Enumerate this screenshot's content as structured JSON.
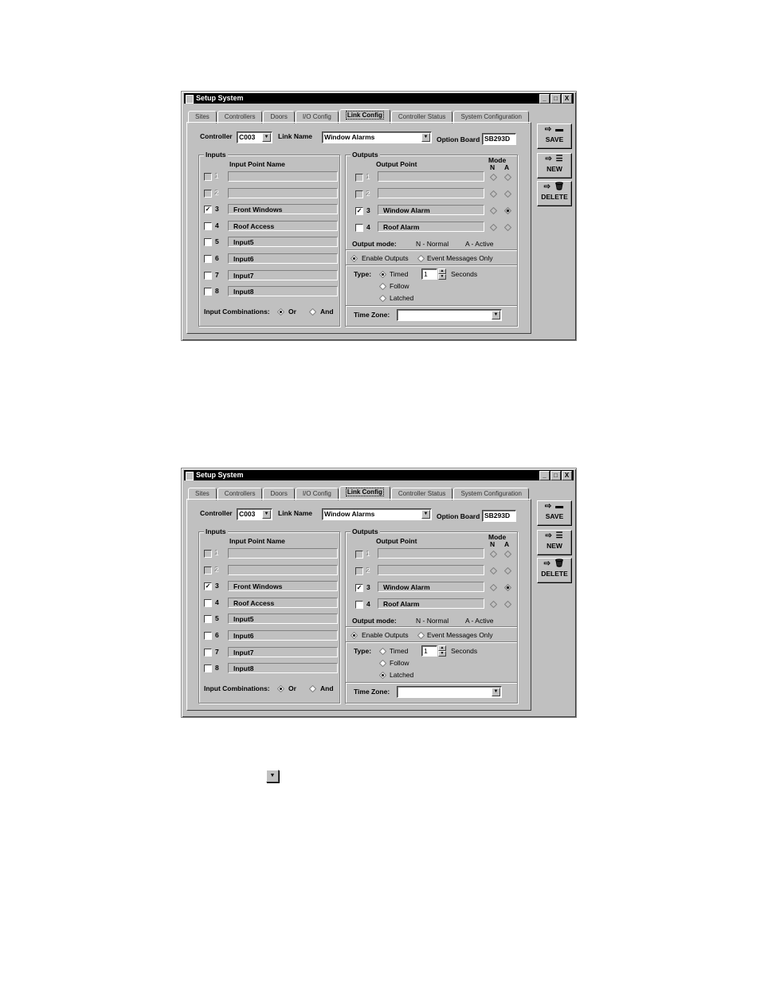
{
  "windows": [
    {
      "title": "Setup System",
      "title_buttons": [
        "_",
        "□",
        "X"
      ],
      "tabs": [
        "Sites",
        "Controllers",
        "Doors",
        "I/O Config",
        "Link Config",
        "Controller Status",
        "System Configuration"
      ],
      "active_tab": "Link Config",
      "controller_label": "Controller",
      "controller_value": "C003",
      "link_name_label": "Link Name",
      "link_name_value": "Window Alarms",
      "option_board_label": "Option Board",
      "option_board_value": "SB293D",
      "inputs": {
        "group_label": "Inputs",
        "header": "Input Point Name",
        "rows": [
          {
            "num": "1",
            "name": "",
            "checked": false,
            "enabled": false
          },
          {
            "num": "2",
            "name": "",
            "checked": false,
            "enabled": false
          },
          {
            "num": "3",
            "name": "Front Windows",
            "checked": true,
            "enabled": true
          },
          {
            "num": "4",
            "name": "Roof Access",
            "checked": false,
            "enabled": true
          },
          {
            "num": "5",
            "name": "Input5",
            "checked": false,
            "enabled": true
          },
          {
            "num": "6",
            "name": "Input6",
            "checked": false,
            "enabled": true
          },
          {
            "num": "7",
            "name": "Input7",
            "checked": false,
            "enabled": true
          },
          {
            "num": "8",
            "name": "Input8",
            "checked": false,
            "enabled": true
          }
        ],
        "combinations_label": "Input Combinations:",
        "or_label": "Or",
        "and_label": "And",
        "combination_selected": "Or"
      },
      "outputs": {
        "group_label": "Outputs",
        "header": "Output Point",
        "mode_header": "Mode",
        "mode_n": "N",
        "mode_a": "A",
        "rows": [
          {
            "num": "1",
            "name": "",
            "checked": false,
            "enabled": false,
            "mode": ""
          },
          {
            "num": "2",
            "name": "",
            "checked": false,
            "enabled": false,
            "mode": ""
          },
          {
            "num": "3",
            "name": "Window Alarm",
            "checked": true,
            "enabled": true,
            "mode": "A"
          },
          {
            "num": "4",
            "name": "Roof Alarm",
            "checked": false,
            "enabled": true,
            "mode": ""
          }
        ],
        "output_mode_label": "Output mode:",
        "normal_legend": "N - Normal",
        "active_legend": "A - Active",
        "enable_outputs_label": "Enable Outputs",
        "event_messages_label": "Event Messages Only",
        "enable_selected": "Enable Outputs",
        "type_label": "Type:",
        "type_options": [
          "Timed",
          "Follow",
          "Latched"
        ],
        "type_selected": "Timed",
        "seconds_value": "1",
        "seconds_label": "Seconds",
        "time_zone_label": "Time Zone:",
        "time_zone_value": ""
      },
      "side_buttons": {
        "save": "SAVE",
        "new": "NEW",
        "delete": "DELETE"
      }
    },
    {
      "title": "Setup System",
      "title_buttons": [
        "_",
        "□",
        "X"
      ],
      "tabs": [
        "Sites",
        "Controllers",
        "Doors",
        "I/O Config",
        "Link Config",
        "Controller Status",
        "System Configuration"
      ],
      "active_tab": "Link Config",
      "controller_label": "Controller",
      "controller_value": "C003",
      "link_name_label": "Link Name",
      "link_name_value": "Window Alarms",
      "option_board_label": "Option Board",
      "option_board_value": "SB293D",
      "inputs": {
        "group_label": "Inputs",
        "header": "Input Point Name",
        "rows": [
          {
            "num": "1",
            "name": "",
            "checked": false,
            "enabled": false
          },
          {
            "num": "2",
            "name": "",
            "checked": false,
            "enabled": false
          },
          {
            "num": "3",
            "name": "Front Windows",
            "checked": true,
            "enabled": true
          },
          {
            "num": "4",
            "name": "Roof Access",
            "checked": false,
            "enabled": true
          },
          {
            "num": "5",
            "name": "Input5",
            "checked": false,
            "enabled": true
          },
          {
            "num": "6",
            "name": "Input6",
            "checked": false,
            "enabled": true
          },
          {
            "num": "7",
            "name": "Input7",
            "checked": false,
            "enabled": true
          },
          {
            "num": "8",
            "name": "Input8",
            "checked": false,
            "enabled": true
          }
        ],
        "combinations_label": "Input Combinations:",
        "or_label": "Or",
        "and_label": "And",
        "combination_selected": "Or"
      },
      "outputs": {
        "group_label": "Outputs",
        "header": "Output Point",
        "mode_header": "Mode",
        "mode_n": "N",
        "mode_a": "A",
        "rows": [
          {
            "num": "1",
            "name": "",
            "checked": false,
            "enabled": false,
            "mode": ""
          },
          {
            "num": "2",
            "name": "",
            "checked": false,
            "enabled": false,
            "mode": ""
          },
          {
            "num": "3",
            "name": "Window Alarm",
            "checked": true,
            "enabled": true,
            "mode": "A"
          },
          {
            "num": "4",
            "name": "Roof Alarm",
            "checked": false,
            "enabled": true,
            "mode": ""
          }
        ],
        "output_mode_label": "Output mode:",
        "normal_legend": "N - Normal",
        "active_legend": "A - Active",
        "enable_outputs_label": "Enable Outputs",
        "event_messages_label": "Event Messages Only",
        "enable_selected": "Enable Outputs",
        "type_label": "Type:",
        "type_options": [
          "Timed",
          "Follow",
          "Latched"
        ],
        "type_selected": "Latched",
        "seconds_value": "1",
        "seconds_label": "Seconds",
        "time_zone_label": "Time Zone:",
        "time_zone_value": ""
      },
      "side_buttons": {
        "save": "SAVE",
        "new": "NEW",
        "delete": "DELETE"
      }
    }
  ],
  "standalone_dropdown_icon": "dropdown-arrow-icon"
}
